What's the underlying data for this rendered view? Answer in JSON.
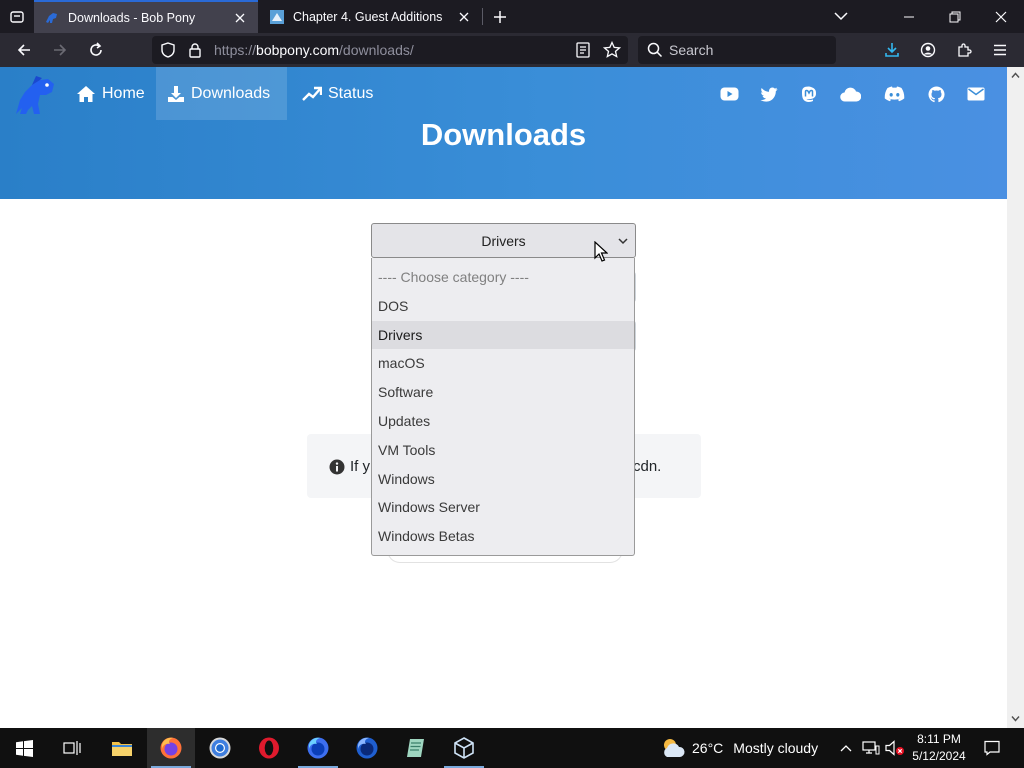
{
  "browser": {
    "tabs": [
      {
        "title": "Downloads - Bob Pony",
        "active": true
      },
      {
        "title": "Chapter 4. Guest Additions",
        "active": false
      }
    ],
    "url": {
      "prefix": "https://",
      "host": "bobpony.com",
      "path": "/downloads/"
    },
    "search_placeholder": "Search",
    "accent": "#2a6ad6"
  },
  "site": {
    "nav": [
      {
        "label": "Home",
        "icon": "home-icon"
      },
      {
        "label": "Downloads",
        "icon": "download-icon",
        "active": true
      },
      {
        "label": "Status",
        "icon": "trending-up-icon"
      }
    ],
    "social_icons": [
      "youtube-icon",
      "twitter-icon",
      "mastodon-icon",
      "cloud-icon",
      "discord-icon",
      "github-icon",
      "email-icon"
    ],
    "page_title": "Downloads",
    "hero_color": "#3a8ed8"
  },
  "category_select": {
    "selected": "Drivers",
    "options": [
      "---- Choose category ----",
      "DOS",
      "Drivers",
      "macOS",
      "Software",
      "Updates",
      "VM Tools",
      "Windows",
      "Windows Server",
      "Windows Betas"
    ]
  },
  "info_notice": {
    "start": "If y",
    "end": "cdn."
  },
  "taskbar": {
    "weather": {
      "temp": "26°C",
      "condition": "Mostly cloudy"
    },
    "time": "8:11 PM",
    "date": "5/12/2024"
  }
}
